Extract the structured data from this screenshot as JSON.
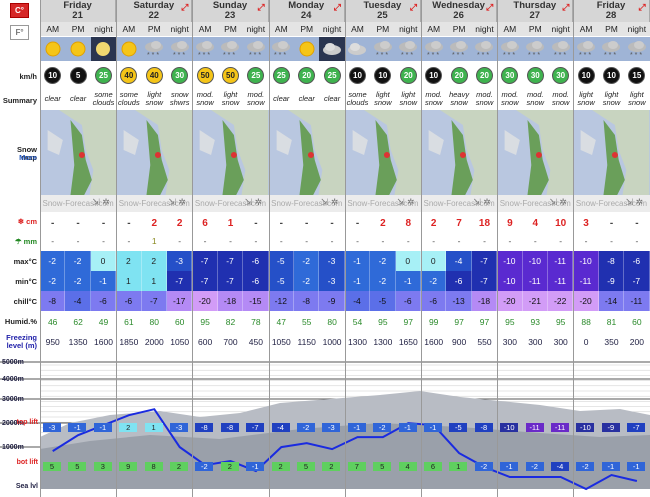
{
  "units": {
    "temp_c": "C°",
    "temp_f": "F°"
  },
  "days": [
    {
      "name": "Friday",
      "date": "21",
      "periods": [
        "night"
      ]
    },
    {
      "name": "Saturday",
      "date": "22",
      "periods": [
        "AM",
        "PM",
        "night"
      ]
    },
    {
      "name": "Sunday",
      "date": "23",
      "periods": [
        "AM",
        "PM",
        "night"
      ]
    },
    {
      "name": "Monday",
      "date": "24",
      "periods": [
        "AM",
        "PM",
        "night"
      ]
    },
    {
      "name": "Tuesday",
      "date": "25",
      "periods": [
        "AM",
        "PM",
        "night"
      ]
    },
    {
      "name": "Wednesday",
      "date": "26",
      "periods": [
        "AM",
        "PM",
        "night"
      ]
    },
    {
      "name": "Thursday",
      "date": "27",
      "periods": [
        "AM",
        "PM",
        "night"
      ]
    },
    {
      "name": "Friday",
      "date": "28",
      "periods": [
        "AM",
        "PM",
        "night"
      ]
    }
  ],
  "first_day_periods": [
    "AM",
    "PM",
    "night"
  ],
  "labels": {
    "wind": "km/h",
    "summary": "Summary",
    "snowmap": "Snow map",
    "more": "More",
    "snow": "cm",
    "rain": "mm",
    "max": "max°C",
    "min": "min°C",
    "chill": "chill°C",
    "humid": "Humid.%",
    "freezing": "Freezing level (m)",
    "top_lift": "top lift",
    "bot_lift": "bot lift",
    "sea": "Sea lvl",
    "brand": "Snow-Forecast.com"
  },
  "altitudes": [
    "5000m",
    "4000m",
    "3000m",
    "2000m",
    "1000m"
  ],
  "columns": [
    {
      "icon": "sun",
      "wind": "10",
      "wd": "↗",
      "summary": "clear",
      "snow": "-",
      "rain": "-",
      "max": "-2",
      "min": "-2",
      "chill": "-8",
      "humid": "46",
      "freeze": "950",
      "top": "-3",
      "bot": "5"
    },
    {
      "icon": "sun",
      "wind": "5",
      "wd": "↗",
      "summary": "clear",
      "snow": "-",
      "rain": "-",
      "max": "-2",
      "min": "-2",
      "chill": "-4",
      "humid": "62",
      "freeze": "1350",
      "top": "-1",
      "bot": "5"
    },
    {
      "icon": "moon",
      "wind": "25",
      "wd": "↗",
      "summary": "some clouds",
      "snow": "-",
      "rain": "-",
      "max": "0",
      "min": "-1",
      "chill": "-6",
      "humid": "49",
      "freeze": "1600",
      "top": "-1",
      "bot": "3"
    },
    {
      "icon": "sun",
      "wind": "40",
      "wd": "↗",
      "summary": "some clouds",
      "snow": "-",
      "rain": "-",
      "max": "2",
      "min": "1",
      "chill": "-6",
      "humid": "61",
      "freeze": "1850",
      "top": "2",
      "bot": "9"
    },
    {
      "icon": "cloudsnow",
      "wind": "40",
      "wd": "↗",
      "summary": "light snow",
      "snow": "2",
      "rain": "1",
      "max": "2",
      "min": "1",
      "chill": "-7",
      "humid": "80",
      "freeze": "2000",
      "top": "1",
      "bot": "8"
    },
    {
      "icon": "cloudsnow",
      "wind": "30",
      "wd": "↗",
      "summary": "snow shwrs",
      "snow": "2",
      "rain": "-",
      "max": "-3",
      "min": "-7",
      "chill": "-17",
      "humid": "60",
      "freeze": "1050",
      "top": "-3",
      "bot": "2"
    },
    {
      "icon": "cloudsnow",
      "wind": "50",
      "wd": "↗",
      "summary": "mod. snow",
      "snow": "6",
      "rain": "-",
      "max": "-7",
      "min": "-7",
      "chill": "-20",
      "humid": "95",
      "freeze": "600",
      "top": "-8",
      "bot": "-2"
    },
    {
      "icon": "cloudsnow",
      "wind": "50",
      "wd": "↗",
      "summary": "light snow",
      "snow": "1",
      "rain": "-",
      "max": "-7",
      "min": "-7",
      "chill": "-18",
      "humid": "82",
      "freeze": "700",
      "top": "-8",
      "bot": "2"
    },
    {
      "icon": "cloudsnow",
      "wind": "25",
      "wd": "→",
      "summary": "mod. snow",
      "snow": "-",
      "rain": "-",
      "max": "-6",
      "min": "-6",
      "chill": "-15",
      "humid": "78",
      "freeze": "450",
      "top": "-7",
      "bot": "-1"
    },
    {
      "icon": "cloudsnow",
      "wind": "25",
      "wd": "→",
      "summary": "clear",
      "snow": "-",
      "rain": "-",
      "max": "-5",
      "min": "-5",
      "chill": "-12",
      "humid": "47",
      "freeze": "1050",
      "top": "-4",
      "bot": "2"
    },
    {
      "icon": "sun",
      "wind": "20",
      "wd": "→",
      "summary": "clear",
      "snow": "-",
      "rain": "-",
      "max": "-2",
      "min": "-2",
      "chill": "-8",
      "humid": "55",
      "freeze": "1150",
      "top": "-2",
      "bot": "5"
    },
    {
      "icon": "cloud",
      "wind": "25",
      "wd": "→",
      "summary": "clear",
      "snow": "-",
      "rain": "-",
      "max": "-3",
      "min": "-3",
      "chill": "-9",
      "humid": "80",
      "freeze": "1000",
      "top": "-3",
      "bot": "2"
    },
    {
      "icon": "cloud",
      "wind": "10",
      "wd": "↗",
      "summary": "some clouds",
      "snow": "-",
      "rain": "-",
      "max": "-1",
      "min": "-1",
      "chill": "-4",
      "humid": "54",
      "freeze": "1300",
      "top": "-1",
      "bot": "7"
    },
    {
      "icon": "cloudsnow",
      "wind": "10",
      "wd": "↗",
      "summary": "light snow",
      "snow": "2",
      "rain": "-",
      "max": "-2",
      "min": "-2",
      "chill": "-5",
      "humid": "95",
      "freeze": "1300",
      "top": "-2",
      "bot": "5"
    },
    {
      "icon": "cloudsnow",
      "wind": "20",
      "wd": "↗",
      "summary": "light snow",
      "snow": "8",
      "rain": "-",
      "max": "0",
      "min": "-1",
      "chill": "-6",
      "humid": "97",
      "freeze": "1650",
      "top": "-1",
      "bot": "4"
    },
    {
      "icon": "cloudsnow",
      "wind": "10",
      "wd": "→",
      "summary": "mod. snow",
      "snow": "2",
      "rain": "-",
      "max": "0",
      "min": "-2",
      "chill": "-6",
      "humid": "99",
      "freeze": "1600",
      "top": "-1",
      "bot": "6"
    },
    {
      "icon": "cloudsnow",
      "wind": "20",
      "wd": "→",
      "summary": "heavy snow",
      "snow": "7",
      "rain": "-",
      "max": "-4",
      "min": "-6",
      "chill": "-13",
      "humid": "97",
      "freeze": "900",
      "top": "-5",
      "bot": "1"
    },
    {
      "icon": "cloudsnow",
      "wind": "20",
      "wd": "→",
      "summary": "mod. snow",
      "snow": "18",
      "rain": "-",
      "max": "-7",
      "min": "-7",
      "chill": "-18",
      "humid": "97",
      "freeze": "550",
      "top": "-8",
      "bot": "-2"
    },
    {
      "icon": "cloudsnow",
      "wind": "30",
      "wd": "↗",
      "summary": "mod. snow",
      "snow": "9",
      "rain": "-",
      "max": "-10",
      "min": "-10",
      "chill": "-20",
      "humid": "95",
      "freeze": "300",
      "top": "-10",
      "bot": "-1"
    },
    {
      "icon": "cloudsnow",
      "wind": "30",
      "wd": "↗",
      "summary": "mod. snow",
      "snow": "4",
      "rain": "-",
      "max": "-10",
      "min": "-11",
      "chill": "-21",
      "humid": "93",
      "freeze": "300",
      "top": "-11",
      "bot": "-2"
    },
    {
      "icon": "cloudsnow",
      "wind": "30",
      "wd": "↗",
      "summary": "mod. snow",
      "snow": "10",
      "rain": "-",
      "max": "-11",
      "min": "-11",
      "chill": "-22",
      "humid": "95",
      "freeze": "300",
      "top": "-11",
      "bot": "-4"
    },
    {
      "icon": "cloudsnow",
      "wind": "10",
      "wd": "↗",
      "summary": "light snow",
      "snow": "3",
      "rain": "-",
      "max": "-10",
      "min": "-11",
      "chill": "-20",
      "humid": "88",
      "freeze": "0",
      "top": "-10",
      "bot": "-2"
    },
    {
      "icon": "cloudsnow",
      "wind": "10",
      "wd": "↗",
      "summary": "light snow",
      "snow": "-",
      "rain": "-",
      "max": "-8",
      "min": "-9",
      "chill": "-14",
      "humid": "81",
      "freeze": "350",
      "top": "-9",
      "bot": "-1"
    },
    {
      "icon": "cloudsnow",
      "wind": "15",
      "wd": "↗",
      "summary": "light snow",
      "snow": "-",
      "rain": "-",
      "max": "-6",
      "min": "-7",
      "chill": "-11",
      "humid": "60",
      "freeze": "200",
      "top": "-7",
      "bot": "-1"
    }
  ]
}
